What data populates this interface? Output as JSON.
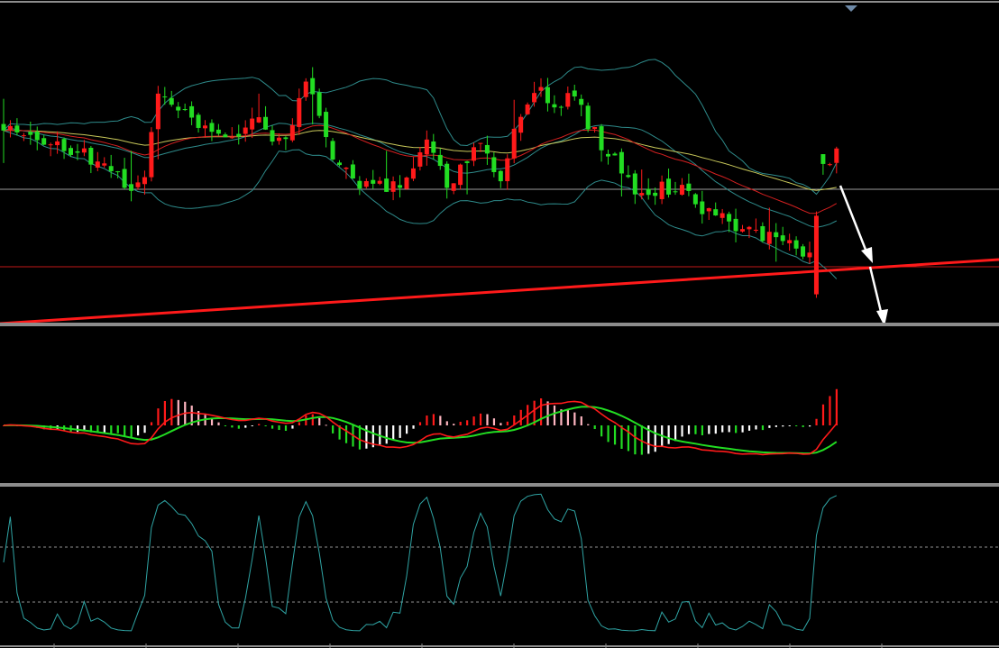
{
  "chart_data": [
    {
      "type": "candlestick",
      "panel": "price",
      "title": "",
      "xlabel": "",
      "ylabel": "",
      "overlays": [
        "bollinger-upper",
        "bollinger-middle",
        "bollinger-lower",
        "moving-average-red",
        "moving-average-yellow"
      ],
      "annotations": [
        "horizontal-line-white",
        "horizontal-line-red",
        "trendline-red",
        "down-arrow-white"
      ],
      "candle_count": 125,
      "grid": false,
      "colors": {
        "up": "#ff1a1a",
        "down": "#22dd22",
        "bollinger": "#2e8b8b",
        "ma_red": "#d42020",
        "ma_yellow": "#c8c85a",
        "trendline": "#ff1a1a",
        "arrow": "#ffffff"
      }
    },
    {
      "type": "bar+line",
      "panel": "macd",
      "title": "",
      "series": [
        {
          "values": []
        },
        {
          "values": []
        }
      ],
      "colors": {
        "bar_up_strong": "#ff1a1a",
        "bar_up_weak": "#ffb6c1",
        "bar_down_strong": "#22dd22",
        "bar_down_weak": "#ffffff",
        "dif": "#ff1a1a",
        "dea": "#22dd22"
      },
      "grid": false
    },
    {
      "type": "line",
      "panel": "oscillator",
      "title": "",
      "levels": [
        "upper",
        "lower"
      ],
      "colors": {
        "line": "#2fa4a4",
        "level": "#bfbfbf"
      },
      "grid": false
    }
  ]
}
